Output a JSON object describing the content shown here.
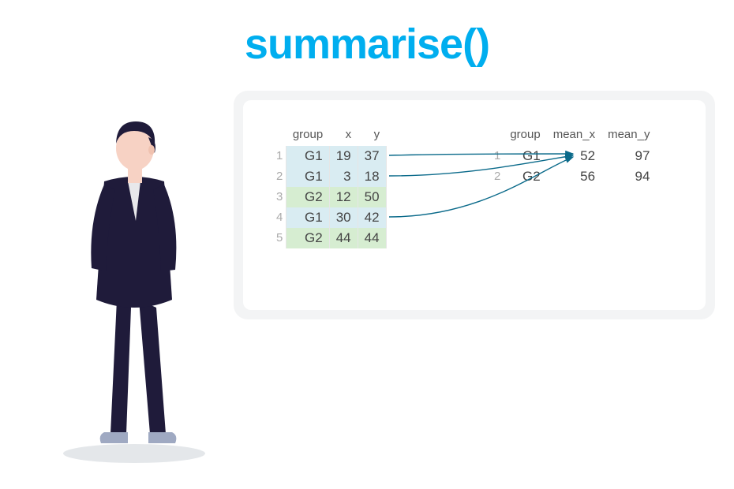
{
  "title": "summarise()",
  "left_table": {
    "headers": [
      "",
      "group",
      "x",
      "y"
    ],
    "rows": [
      {
        "idx": "1",
        "group": "G1",
        "x": "19",
        "y": "37",
        "cls": "g1"
      },
      {
        "idx": "2",
        "group": "G1",
        "x": "3",
        "y": "18",
        "cls": "g1"
      },
      {
        "idx": "3",
        "group": "G2",
        "x": "12",
        "y": "50",
        "cls": "g2"
      },
      {
        "idx": "4",
        "group": "G1",
        "x": "30",
        "y": "42",
        "cls": "g1"
      },
      {
        "idx": "5",
        "group": "G2",
        "x": "44",
        "y": "44",
        "cls": "g2"
      }
    ]
  },
  "right_table": {
    "headers": [
      "",
      "group",
      "mean_x",
      "mean_y"
    ],
    "rows": [
      {
        "idx": "1",
        "group": "G1",
        "mean_x": "52",
        "mean_y": "97"
      },
      {
        "idx": "2",
        "group": "G2",
        "mean_x": "56",
        "mean_y": "94"
      }
    ]
  },
  "arrows": {
    "color": "#0a6a8a",
    "paths": [
      "M185,70 C260,68 350,68 418,68",
      "M185,96 C280,96 360,80 418,70",
      "M185,148 C300,148 370,92 418,72"
    ]
  },
  "colors": {
    "title": "#00aeef",
    "panel": "#f3f4f5",
    "suit": "#1f1b3a",
    "skin": "#f7d2c4",
    "shirt": "#e8e8eb"
  }
}
